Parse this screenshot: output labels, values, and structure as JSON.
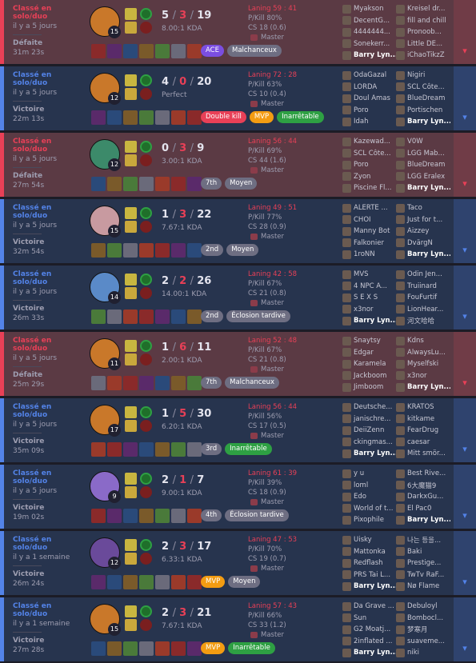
{
  "matches": [
    {
      "queue": "Classé en solo/duo",
      "ago": "il y a 5 jours",
      "result": "Défaite",
      "duration": "31m 23s",
      "level": "15",
      "kills": "5",
      "deaths": "3",
      "assists": "19",
      "ratio": "8.00:1 KDA",
      "lane": "Laning 59 : 41",
      "pkill": "P/Kill 80%",
      "cs": "CS 18 (0.6)",
      "rank": "Master",
      "badges": [
        {
          "t": "ACE",
          "c": "ace"
        },
        {
          "t": "Malchanceux",
          "c": "grey"
        }
      ],
      "team1": [
        "Myakson",
        "DecentG...",
        "4444444...",
        "Sonekerr...",
        "Barry Lyn..."
      ],
      "team2": [
        "Kreisel dr...",
        "fill and chill",
        "Pronoob...",
        "Little DE...",
        "iChaoTikzZ"
      ],
      "champColor": "#c9782a",
      "win": false
    },
    {
      "queue": "Classé en solo/duo",
      "ago": "il y a 5 jours",
      "result": "Victoire",
      "duration": "22m 13s",
      "level": "12",
      "kills": "4",
      "deaths": "0",
      "assists": "20",
      "ratio": "Perfect",
      "lane": "Laning 72 : 28",
      "pkill": "P/Kill 63%",
      "cs": "CS 10 (0.4)",
      "rank": "Master",
      "badges": [
        {
          "t": "Double kill",
          "c": "red"
        },
        {
          "t": "MVP",
          "c": "orange"
        },
        {
          "t": "Inarrêtable",
          "c": "green"
        }
      ],
      "team1": [
        "OdaGazal",
        "LORDA",
        "Doul Amas",
        "Poro",
        "Idah"
      ],
      "team2": [
        "Nigiri",
        "SCL Côte...",
        "BlueDream",
        "Portischen",
        "Barry Lyn..."
      ],
      "champColor": "#c9782a",
      "win": true
    },
    {
      "queue": "Classé en solo/duo",
      "ago": "il y a 5 jours",
      "result": "Défaite",
      "duration": "27m 54s",
      "level": "12",
      "kills": "0",
      "deaths": "3",
      "assists": "9",
      "ratio": "3.00:1 KDA",
      "lane": "Laning 56 : 44",
      "pkill": "P/Kill 69%",
      "cs": "CS 44 (1.6)",
      "rank": "Master",
      "badges": [
        {
          "t": "7th",
          "c": "grey"
        },
        {
          "t": "Moyen",
          "c": "grey"
        }
      ],
      "team1": [
        "Kazewad...",
        "SCL Côte...",
        "Poro",
        "Zyon",
        "Piscine Fl..."
      ],
      "team2": [
        "V0W",
        "LGG Mab...",
        "BlueDream",
        "LGG Eralex",
        "Barry Lyn..."
      ],
      "champColor": "#3c8a6a",
      "win": false
    },
    {
      "queue": "Classé en solo/duo",
      "ago": "il y a 5 jours",
      "result": "Victoire",
      "duration": "32m 54s",
      "level": "15",
      "kills": "1",
      "deaths": "3",
      "assists": "22",
      "ratio": "7.67:1 KDA",
      "lane": "Laning 49 : 51",
      "pkill": "P/Kill 77%",
      "cs": "CS 28 (0.9)",
      "rank": "Master",
      "badges": [
        {
          "t": "2nd",
          "c": "grey"
        },
        {
          "t": "Moyen",
          "c": "grey"
        }
      ],
      "team1": [
        "ALERTE ...",
        "CHOI",
        "Manny Bot",
        "Falkonier",
        "1roNN"
      ],
      "team2": [
        "Taco",
        "Just for t...",
        "Aizzey",
        "DvärgN",
        "Barry Lyn..."
      ],
      "champColor": "#c89aa0",
      "win": true
    },
    {
      "queue": "Classé en solo/duo",
      "ago": "il y a 5 jours",
      "result": "Victoire",
      "duration": "26m 33s",
      "level": "14",
      "kills": "2",
      "deaths": "2",
      "assists": "26",
      "ratio": "14.00:1 KDA",
      "lane": "Laning 42 : 58",
      "pkill": "P/Kill 67%",
      "cs": "CS 21 (0.8)",
      "rank": "Master",
      "badges": [
        {
          "t": "2nd",
          "c": "grey"
        },
        {
          "t": "Éclosion tardive",
          "c": "grey"
        }
      ],
      "team1": [
        "MVS",
        "4 NPC A...",
        "S E X S",
        "x3nor",
        "Barry Lyn..."
      ],
      "team2": [
        "Odin Jen...",
        "Truiinard",
        "FouFurtif",
        "LionHear...",
        "河文哈哈"
      ],
      "champColor": "#5a8ac8",
      "win": true
    },
    {
      "queue": "Classé en solo/duo",
      "ago": "il y a 5 jours",
      "result": "Défaite",
      "duration": "25m 29s",
      "level": "11",
      "kills": "1",
      "deaths": "6",
      "assists": "11",
      "ratio": "2.00:1 KDA",
      "lane": "Laning 52 : 48",
      "pkill": "P/Kill 67%",
      "cs": "CS 21 (0.8)",
      "rank": "Master",
      "badges": [
        {
          "t": "7th",
          "c": "grey"
        },
        {
          "t": "Malchanceux",
          "c": "grey"
        }
      ],
      "team1": [
        "Snaytsy",
        "Edgar",
        "Karamela",
        "Jackboom",
        "Jimboom"
      ],
      "team2": [
        "Kdns",
        "AlwaysLu...",
        "Myselfski",
        "x3nor",
        "Barry Lyn..."
      ],
      "champColor": "#c9782a",
      "win": false
    },
    {
      "queue": "Classé en solo/duo",
      "ago": "il y a 5 jours",
      "result": "Victoire",
      "duration": "35m 09s",
      "level": "17",
      "kills": "1",
      "deaths": "5",
      "assists": "30",
      "ratio": "6.20:1 KDA",
      "lane": "Laning 56 : 44",
      "pkill": "P/Kill 56%",
      "cs": "CS 17 (0.5)",
      "rank": "Master",
      "badges": [
        {
          "t": "3rd",
          "c": "grey"
        },
        {
          "t": "Inarrêtable",
          "c": "green"
        }
      ],
      "team1": [
        "Deutsche...",
        "janischre...",
        "DeiiZenn",
        "ckingmas...",
        "Barry Lyn..."
      ],
      "team2": [
        "KRATOS",
        "kitkame",
        "FearDrug",
        "caesar",
        "Mitt smör..."
      ],
      "champColor": "#c9782a",
      "win": true
    },
    {
      "queue": "Classé en solo/duo",
      "ago": "il y a 5 jours",
      "result": "Victoire",
      "duration": "19m 02s",
      "level": "9",
      "kills": "2",
      "deaths": "1",
      "assists": "7",
      "ratio": "9.00:1 KDA",
      "lane": "Laning 61 : 39",
      "pkill": "P/Kill 39%",
      "cs": "CS 18 (0.9)",
      "rank": "Master",
      "badges": [
        {
          "t": "4th",
          "c": "grey"
        },
        {
          "t": "Éclosion tardive",
          "c": "grey"
        }
      ],
      "team1": [
        "y u",
        "loml",
        "Edo",
        "World of t...",
        "Pixophile"
      ],
      "team2": [
        "Best Rive...",
        "6大魔猫9",
        "DarkxGu...",
        "El Pac0",
        "Barry Lyn..."
      ],
      "champColor": "#8a6ac8",
      "win": true
    },
    {
      "queue": "Classé en solo/duo",
      "ago": "il y a 1 semaine",
      "result": "Victoire",
      "duration": "26m 24s",
      "level": "12",
      "kills": "2",
      "deaths": "3",
      "assists": "17",
      "ratio": "6.33:1 KDA",
      "lane": "Laning 47 : 53",
      "pkill": "P/Kill 70%",
      "cs": "CS 19 (0.7)",
      "rank": "Master",
      "badges": [
        {
          "t": "MVP",
          "c": "orange"
        },
        {
          "t": "Moyen",
          "c": "grey"
        }
      ],
      "team1": [
        "Uisky",
        "Mattonka",
        "Redflash",
        "PRS Tai L...",
        "Barry Lyn..."
      ],
      "team2": [
        "나는 등을...",
        "Baki",
        "Prestige...",
        "TwTv RaF...",
        "Nø Flame"
      ],
      "champColor": "#6a4a9a",
      "win": true
    },
    {
      "queue": "Classé en solo/duo",
      "ago": "il y a 1 semaine",
      "result": "Victoire",
      "duration": "27m 28s",
      "level": "15",
      "kills": "2",
      "deaths": "3",
      "assists": "21",
      "ratio": "7.67:1 KDA",
      "lane": "Laning 57 : 43",
      "pkill": "P/Kill 66%",
      "cs": "CS 33 (1.2)",
      "rank": "Master",
      "badges": [
        {
          "t": "MVP",
          "c": "orange"
        },
        {
          "t": "Inarrêtable",
          "c": "green"
        }
      ],
      "team1": [
        "Da Grave ...",
        "Sun",
        "G2 Moatj...",
        "2inflated ...",
        "Barry Lyn..."
      ],
      "team2": [
        "Debuloyl",
        "Bombocl...",
        "梦寒月",
        "suaveme...",
        "niki"
      ],
      "champColor": "#c9782a",
      "win": true
    }
  ]
}
